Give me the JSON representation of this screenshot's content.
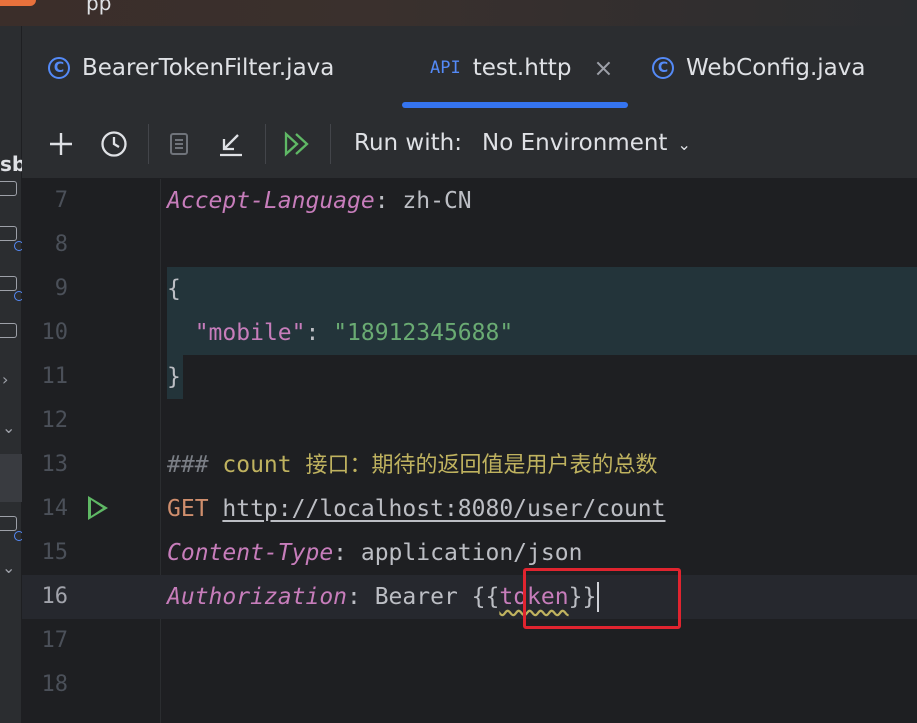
{
  "window": {
    "app_fragment": "pp"
  },
  "sidebar": {
    "tree_label": "sb"
  },
  "tabs": [
    {
      "label": "BearerTokenFilter.java",
      "icon": "java-class-icon",
      "icon_glyph": "C",
      "active": false
    },
    {
      "label": "test.http",
      "icon": "api-icon",
      "icon_glyph": "API",
      "active": true
    },
    {
      "label": "WebConfig.java",
      "icon": "java-class-icon",
      "icon_glyph": "C",
      "active": false
    }
  ],
  "toolbar": {
    "add_icon": "plus-icon",
    "history_icon": "clock-icon",
    "run_with_label": "Run with:",
    "environment": "No Environment"
  },
  "editor": {
    "current_line": 16,
    "lines": [
      {
        "n": "7",
        "tokens": [
          [
            "k-header",
            "Accept-Language"
          ],
          [
            "k-plain",
            ": zh-CN"
          ]
        ]
      },
      {
        "n": "8",
        "tokens": []
      },
      {
        "n": "9",
        "tokens": [
          [
            "k-brace",
            "{"
          ]
        ]
      },
      {
        "n": "10",
        "tokens": [
          [
            "k-plain",
            "  "
          ],
          [
            "k-key",
            "\"mobile\""
          ],
          [
            "k-plain",
            ": "
          ],
          [
            "k-str",
            "\"18912345688\""
          ]
        ]
      },
      {
        "n": "11",
        "tokens": [
          [
            "k-brace",
            "}"
          ]
        ]
      },
      {
        "n": "12",
        "tokens": []
      },
      {
        "n": "13",
        "tokens": [
          [
            "k-comment",
            "### "
          ],
          [
            "k-title",
            "count "
          ],
          [
            "k-cn",
            "接口：期待的返回值是用户表的总数"
          ]
        ]
      },
      {
        "n": "14",
        "tokens": [
          [
            "k-method",
            "GET "
          ],
          [
            "k-url",
            "http://localhost:8080/user/count"
          ]
        ]
      },
      {
        "n": "15",
        "tokens": [
          [
            "k-header",
            "Content-Type"
          ],
          [
            "k-plain",
            ": application/json"
          ]
        ]
      },
      {
        "n": "16",
        "tokens": [
          [
            "k-header",
            "Authorization"
          ],
          [
            "k-plain",
            ": Bearer "
          ],
          [
            "k-brace",
            "{{"
          ],
          [
            "k-var",
            "token"
          ],
          [
            "k-brace",
            "}}"
          ]
        ]
      },
      {
        "n": "17",
        "tokens": []
      },
      {
        "n": "18",
        "tokens": []
      }
    ]
  },
  "colors": {
    "accent": "#3574f0",
    "highlight_box": "#e0242f",
    "run_gutter": "#5fb865"
  }
}
